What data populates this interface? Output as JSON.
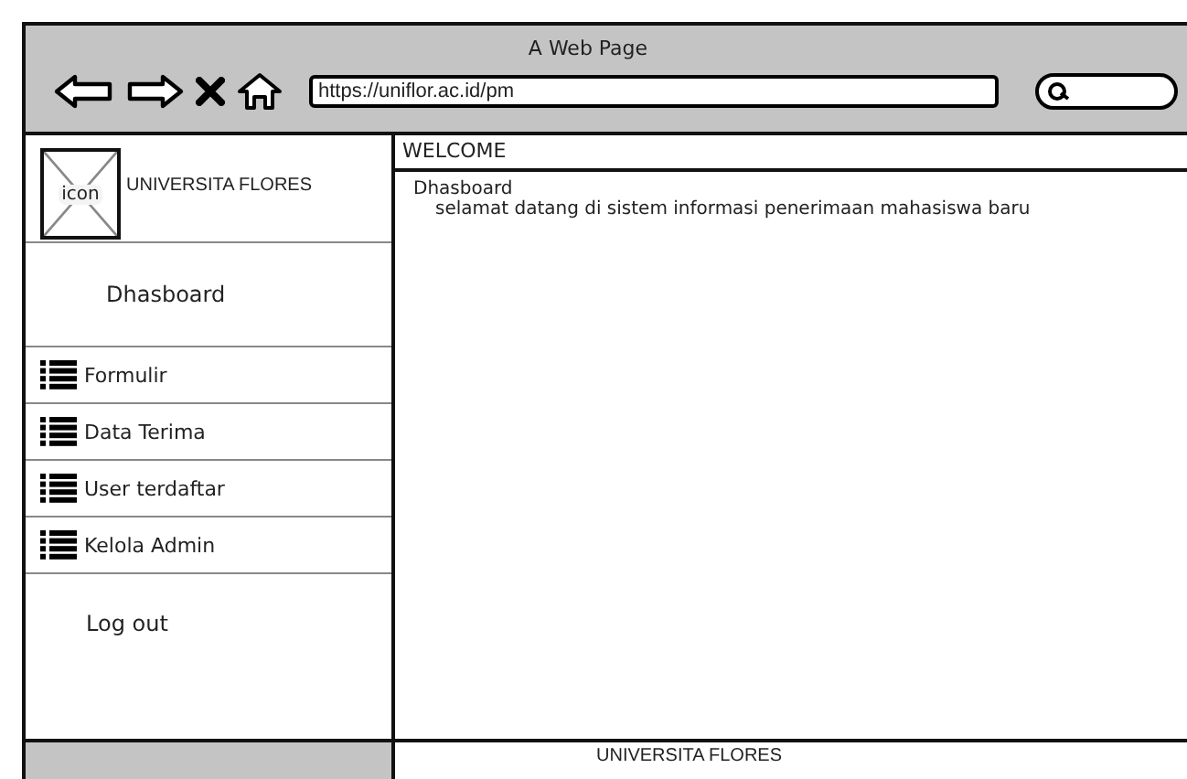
{
  "window": {
    "title": "A Web Page",
    "address": "https://uniflor.ac.id/pm"
  },
  "brand": {
    "logo_label": "icon",
    "name": "UNIVERSITA FLORES"
  },
  "sidebar": {
    "items": [
      {
        "kind": "plain",
        "label": "Dhasboard"
      },
      {
        "kind": "list",
        "label": "Formulir"
      },
      {
        "kind": "list",
        "label": "Data Terima"
      },
      {
        "kind": "list",
        "label": "User terdaftar"
      },
      {
        "kind": "list",
        "label": "Kelola Admin"
      },
      {
        "kind": "plain",
        "label": "Log out"
      }
    ]
  },
  "main": {
    "header": "WELCOME",
    "heading": "Dhasboard",
    "text": "selamat datang di sistem informasi penerimaan mahasiswa baru"
  },
  "footer": {
    "text": "UNIVERSITA FLORES"
  }
}
